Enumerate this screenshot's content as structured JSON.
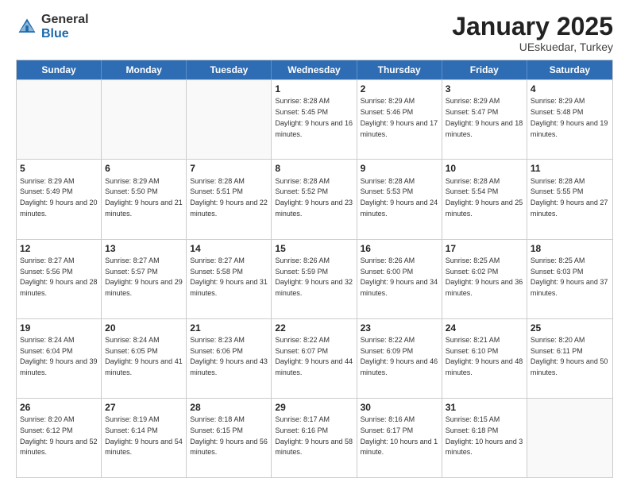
{
  "header": {
    "logo_general": "General",
    "logo_blue": "Blue",
    "month_title": "January 2025",
    "subtitle": "UEskuedar, Turkey"
  },
  "days_of_week": [
    "Sunday",
    "Monday",
    "Tuesday",
    "Wednesday",
    "Thursday",
    "Friday",
    "Saturday"
  ],
  "weeks": [
    [
      {
        "day": "",
        "sunrise": "",
        "sunset": "",
        "daylight": ""
      },
      {
        "day": "",
        "sunrise": "",
        "sunset": "",
        "daylight": ""
      },
      {
        "day": "",
        "sunrise": "",
        "sunset": "",
        "daylight": ""
      },
      {
        "day": "1",
        "sunrise": "Sunrise: 8:28 AM",
        "sunset": "Sunset: 5:45 PM",
        "daylight": "Daylight: 9 hours and 16 minutes."
      },
      {
        "day": "2",
        "sunrise": "Sunrise: 8:29 AM",
        "sunset": "Sunset: 5:46 PM",
        "daylight": "Daylight: 9 hours and 17 minutes."
      },
      {
        "day": "3",
        "sunrise": "Sunrise: 8:29 AM",
        "sunset": "Sunset: 5:47 PM",
        "daylight": "Daylight: 9 hours and 18 minutes."
      },
      {
        "day": "4",
        "sunrise": "Sunrise: 8:29 AM",
        "sunset": "Sunset: 5:48 PM",
        "daylight": "Daylight: 9 hours and 19 minutes."
      }
    ],
    [
      {
        "day": "5",
        "sunrise": "Sunrise: 8:29 AM",
        "sunset": "Sunset: 5:49 PM",
        "daylight": "Daylight: 9 hours and 20 minutes."
      },
      {
        "day": "6",
        "sunrise": "Sunrise: 8:29 AM",
        "sunset": "Sunset: 5:50 PM",
        "daylight": "Daylight: 9 hours and 21 minutes."
      },
      {
        "day": "7",
        "sunrise": "Sunrise: 8:28 AM",
        "sunset": "Sunset: 5:51 PM",
        "daylight": "Daylight: 9 hours and 22 minutes."
      },
      {
        "day": "8",
        "sunrise": "Sunrise: 8:28 AM",
        "sunset": "Sunset: 5:52 PM",
        "daylight": "Daylight: 9 hours and 23 minutes."
      },
      {
        "day": "9",
        "sunrise": "Sunrise: 8:28 AM",
        "sunset": "Sunset: 5:53 PM",
        "daylight": "Daylight: 9 hours and 24 minutes."
      },
      {
        "day": "10",
        "sunrise": "Sunrise: 8:28 AM",
        "sunset": "Sunset: 5:54 PM",
        "daylight": "Daylight: 9 hours and 25 minutes."
      },
      {
        "day": "11",
        "sunrise": "Sunrise: 8:28 AM",
        "sunset": "Sunset: 5:55 PM",
        "daylight": "Daylight: 9 hours and 27 minutes."
      }
    ],
    [
      {
        "day": "12",
        "sunrise": "Sunrise: 8:27 AM",
        "sunset": "Sunset: 5:56 PM",
        "daylight": "Daylight: 9 hours and 28 minutes."
      },
      {
        "day": "13",
        "sunrise": "Sunrise: 8:27 AM",
        "sunset": "Sunset: 5:57 PM",
        "daylight": "Daylight: 9 hours and 29 minutes."
      },
      {
        "day": "14",
        "sunrise": "Sunrise: 8:27 AM",
        "sunset": "Sunset: 5:58 PM",
        "daylight": "Daylight: 9 hours and 31 minutes."
      },
      {
        "day": "15",
        "sunrise": "Sunrise: 8:26 AM",
        "sunset": "Sunset: 5:59 PM",
        "daylight": "Daylight: 9 hours and 32 minutes."
      },
      {
        "day": "16",
        "sunrise": "Sunrise: 8:26 AM",
        "sunset": "Sunset: 6:00 PM",
        "daylight": "Daylight: 9 hours and 34 minutes."
      },
      {
        "day": "17",
        "sunrise": "Sunrise: 8:25 AM",
        "sunset": "Sunset: 6:02 PM",
        "daylight": "Daylight: 9 hours and 36 minutes."
      },
      {
        "day": "18",
        "sunrise": "Sunrise: 8:25 AM",
        "sunset": "Sunset: 6:03 PM",
        "daylight": "Daylight: 9 hours and 37 minutes."
      }
    ],
    [
      {
        "day": "19",
        "sunrise": "Sunrise: 8:24 AM",
        "sunset": "Sunset: 6:04 PM",
        "daylight": "Daylight: 9 hours and 39 minutes."
      },
      {
        "day": "20",
        "sunrise": "Sunrise: 8:24 AM",
        "sunset": "Sunset: 6:05 PM",
        "daylight": "Daylight: 9 hours and 41 minutes."
      },
      {
        "day": "21",
        "sunrise": "Sunrise: 8:23 AM",
        "sunset": "Sunset: 6:06 PM",
        "daylight": "Daylight: 9 hours and 43 minutes."
      },
      {
        "day": "22",
        "sunrise": "Sunrise: 8:22 AM",
        "sunset": "Sunset: 6:07 PM",
        "daylight": "Daylight: 9 hours and 44 minutes."
      },
      {
        "day": "23",
        "sunrise": "Sunrise: 8:22 AM",
        "sunset": "Sunset: 6:09 PM",
        "daylight": "Daylight: 9 hours and 46 minutes."
      },
      {
        "day": "24",
        "sunrise": "Sunrise: 8:21 AM",
        "sunset": "Sunset: 6:10 PM",
        "daylight": "Daylight: 9 hours and 48 minutes."
      },
      {
        "day": "25",
        "sunrise": "Sunrise: 8:20 AM",
        "sunset": "Sunset: 6:11 PM",
        "daylight": "Daylight: 9 hours and 50 minutes."
      }
    ],
    [
      {
        "day": "26",
        "sunrise": "Sunrise: 8:20 AM",
        "sunset": "Sunset: 6:12 PM",
        "daylight": "Daylight: 9 hours and 52 minutes."
      },
      {
        "day": "27",
        "sunrise": "Sunrise: 8:19 AM",
        "sunset": "Sunset: 6:14 PM",
        "daylight": "Daylight: 9 hours and 54 minutes."
      },
      {
        "day": "28",
        "sunrise": "Sunrise: 8:18 AM",
        "sunset": "Sunset: 6:15 PM",
        "daylight": "Daylight: 9 hours and 56 minutes."
      },
      {
        "day": "29",
        "sunrise": "Sunrise: 8:17 AM",
        "sunset": "Sunset: 6:16 PM",
        "daylight": "Daylight: 9 hours and 58 minutes."
      },
      {
        "day": "30",
        "sunrise": "Sunrise: 8:16 AM",
        "sunset": "Sunset: 6:17 PM",
        "daylight": "Daylight: 10 hours and 1 minute."
      },
      {
        "day": "31",
        "sunrise": "Sunrise: 8:15 AM",
        "sunset": "Sunset: 6:18 PM",
        "daylight": "Daylight: 10 hours and 3 minutes."
      },
      {
        "day": "",
        "sunrise": "",
        "sunset": "",
        "daylight": ""
      }
    ]
  ]
}
